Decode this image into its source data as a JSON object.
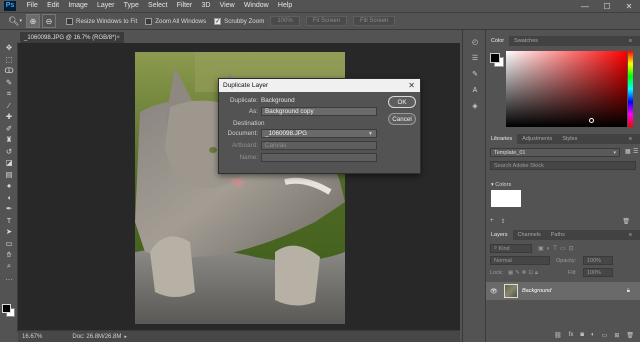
{
  "app": {
    "logo": "Ps"
  },
  "menubar": {
    "items": [
      "File",
      "Edit",
      "Image",
      "Layer",
      "Type",
      "Select",
      "Filter",
      "3D",
      "View",
      "Window",
      "Help"
    ],
    "window_controls": [
      "—",
      "☐",
      "✕"
    ]
  },
  "options_bar": {
    "tool_icon": "zoom-icon",
    "resize_windows_label": "Resize Windows to Fit",
    "zoom_all_label": "Zoom All Windows",
    "scrubby_zoom_label": "Scrubby Zoom",
    "percent_btn": "100%",
    "fit_screen_btn": "Fit Screen",
    "fill_screen_btn": "Fill Screen"
  },
  "document": {
    "tab_title": "_1060098.JPG @ 16.7% (RGB/8*)",
    "zoom": "16.67%",
    "doc_info": "Doc: 26.8M/26.8M"
  },
  "dialog": {
    "title": "Duplicate Layer",
    "duplicate_label": "Duplicate:",
    "duplicate_value": "Background",
    "as_label": "As:",
    "as_value": "Background copy",
    "destination_label": "Destination",
    "document_label": "Document:",
    "document_value": "_1060098.JPG",
    "artboard_label": "Artboard:",
    "artboard_value": "Canvas",
    "name_label": "Name:",
    "ok_label": "OK",
    "cancel_label": "Cancel"
  },
  "panels": {
    "color_tabs": [
      "Color",
      "Swatches"
    ],
    "library_tabs": [
      "Libraries",
      "Adjustments",
      "Styles"
    ],
    "library_select": "Template_01",
    "library_search_placeholder": "Search Adobe Stock",
    "colors_section": "Colors",
    "layers_tabs": [
      "Layers",
      "Channels",
      "Paths"
    ],
    "kind_label": "Kind",
    "blend_mode": "Normal",
    "opacity_label": "Opacity:",
    "opacity_value": "100%",
    "lock_label": "Lock:",
    "fill_label": "Fill:",
    "fill_value": "100%",
    "layer_name": "Background"
  },
  "colors": {
    "foreground": "#000000",
    "background": "#ffffff",
    "picker_hue": "#ff0000"
  }
}
